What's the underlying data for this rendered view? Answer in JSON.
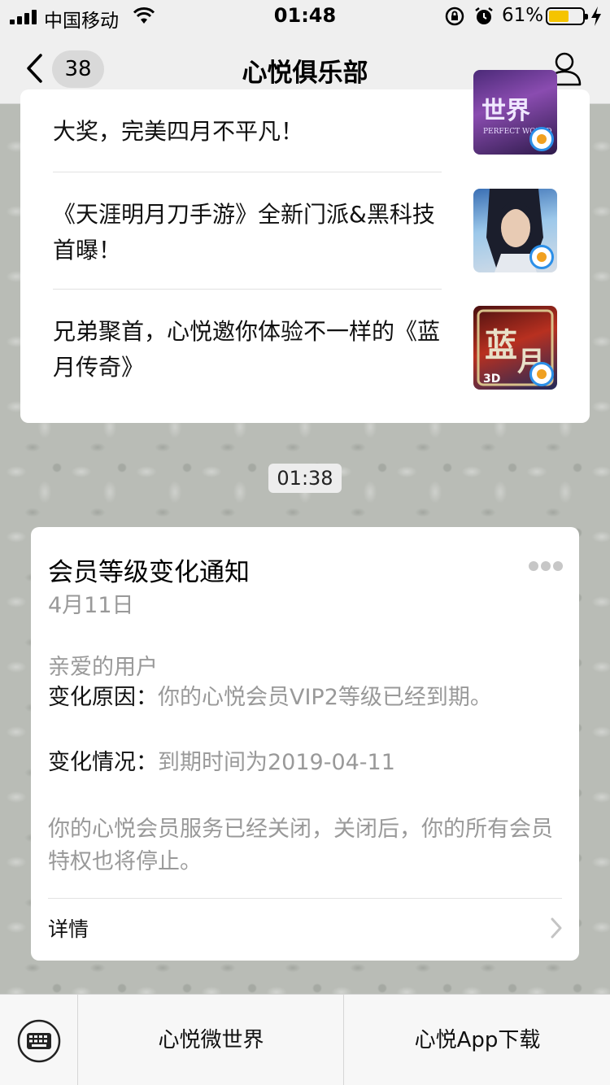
{
  "status_bar": {
    "carrier": "中国移动",
    "time": "01:48",
    "battery_percent": "61%",
    "battery_level": 0.61
  },
  "nav": {
    "unread_count": "38",
    "title": "心悦俱乐部"
  },
  "articles": [
    {
      "text": "大奖，完美四月不平凡！"
    },
    {
      "text": "《天涯明月刀手游》全新门派&黑科技首曝！"
    },
    {
      "text": "兄弟聚首，心悦邀你体验不一样的《蓝月传奇》"
    }
  ],
  "timestamp": "01:38",
  "notice": {
    "title": "会员等级变化通知",
    "date": "4月11日",
    "greeting": "亲爱的用户",
    "reason_label": "变化原因：",
    "reason_value": "你的心悦会员VIP2等级已经到期。",
    "status_label": "变化情况：",
    "status_value": "到期时间为2019-04-11",
    "closing": "你的心悦会员服务已经关闭，关闭后，你的所有会员特权也将停止。",
    "details_label": "详情"
  },
  "bottom_menu": {
    "items": [
      "心悦微世界",
      "心悦App下载"
    ]
  },
  "colors": {
    "battery_fill": "#f5c400",
    "logo_blue": "#2b8fe8"
  }
}
